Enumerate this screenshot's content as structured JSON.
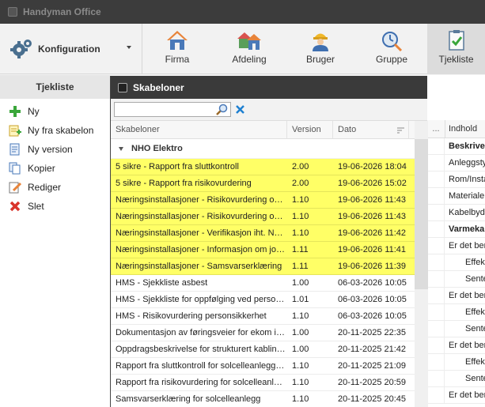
{
  "app": {
    "title": "Handyman Office"
  },
  "ribbon": {
    "config_label": "Konfiguration",
    "buttons": [
      {
        "label": "Firma",
        "icon": "house-icon"
      },
      {
        "label": "Afdeling",
        "icon": "houses-icon"
      },
      {
        "label": "Bruger",
        "icon": "worker-icon"
      },
      {
        "label": "Gruppe",
        "icon": "stopwatch-icon"
      },
      {
        "label": "Tjekliste",
        "icon": "checklist-icon"
      }
    ]
  },
  "sidebar": {
    "title": "Tjekliste",
    "items": [
      {
        "label": "Ny",
        "icon": "plus-icon"
      },
      {
        "label": "Ny fra skabelon",
        "icon": "template-add-icon"
      },
      {
        "label": "Ny version",
        "icon": "new-version-icon"
      },
      {
        "label": "Kopier",
        "icon": "copy-icon"
      },
      {
        "label": "Rediger",
        "icon": "edit-icon"
      },
      {
        "label": "Slet",
        "icon": "delete-icon"
      }
    ]
  },
  "dialog": {
    "title": "Skabeloner",
    "search": {
      "value": "",
      "placeholder": ""
    },
    "columns": {
      "name": "Skabeloner",
      "version": "Version",
      "date": "Dato",
      "more": "..."
    },
    "group": "NHO Elektro",
    "rows": [
      {
        "name": "5 sikre - Rapport fra sluttkontroll",
        "version": "2.00",
        "date": "19-06-2026 18:04",
        "highlight": true
      },
      {
        "name": "5 sikre - Rapport fra risikovurdering",
        "version": "2.00",
        "date": "19-06-2026 15:02",
        "highlight": true
      },
      {
        "name": "Næringsinstallasjoner - Risikovurdering og…",
        "version": "1.10",
        "date": "19-06-2026 11:43",
        "highlight": true
      },
      {
        "name": "Næringsinstallasjoner - Risikovurdering og…",
        "version": "1.10",
        "date": "19-06-2026 11:43",
        "highlight": true
      },
      {
        "name": "Næringsinstallasjoner - Verifikasjon iht. N…",
        "version": "1.10",
        "date": "19-06-2026 11:42",
        "highlight": true
      },
      {
        "name": "Næringsinstallasjoner - Informasjon om jo…",
        "version": "1.11",
        "date": "19-06-2026 11:41",
        "highlight": true
      },
      {
        "name": "Næringsinstallasjoner - Samsvarserklæring",
        "version": "1.11",
        "date": "19-06-2026 11:39",
        "highlight": true
      },
      {
        "name": "HMS - Sjekkliste asbest",
        "version": "1.00",
        "date": "06-03-2026 10:05",
        "highlight": false
      },
      {
        "name": "HMS - Sjekkliste for oppfølging ved person…",
        "version": "1.01",
        "date": "06-03-2026 10:05",
        "highlight": false
      },
      {
        "name": "HMS - Risikovurdering personsikkerhet",
        "version": "1.10",
        "date": "06-03-2026 10:05",
        "highlight": false
      },
      {
        "name": "Dokumentasjon av føringsveier for ekom i …",
        "version": "1.00",
        "date": "20-11-2025 22:35",
        "highlight": false
      },
      {
        "name": "Oppdragsbeskrivelse for strukturert kablin…",
        "version": "1.00",
        "date": "20-11-2025 21:42",
        "highlight": false
      },
      {
        "name": "Rapport fra sluttkontroll for solcelleanlegg…",
        "version": "1.10",
        "date": "20-11-2025 21:09",
        "highlight": false
      },
      {
        "name": "Rapport fra risikovurdering for solcelleanl…",
        "version": "1.10",
        "date": "20-11-2025 20:59",
        "highlight": false
      },
      {
        "name": "Samsvarserklæring for solcelleanlegg",
        "version": "1.10",
        "date": "20-11-2025 20:45",
        "highlight": false
      }
    ]
  },
  "content_panel": {
    "header": "Indhold",
    "rows": [
      {
        "text": "Beskrivelse",
        "style": "bold"
      },
      {
        "text": "Anleggstype",
        "style": "normal"
      },
      {
        "text": "Rom/Installasjon",
        "style": "normal"
      },
      {
        "text": "Materiale",
        "style": "normal"
      },
      {
        "text": "Kabelbydel",
        "style": "normal"
      },
      {
        "text": "Varmekabel",
        "style": "bold"
      },
      {
        "text": "Er det benyttet",
        "style": "normal"
      },
      {
        "text": "Effekt",
        "style": "indent"
      },
      {
        "text": "Sentes",
        "style": "indent"
      },
      {
        "text": "Er det benyttet",
        "style": "normal"
      },
      {
        "text": "Effekt",
        "style": "indent"
      },
      {
        "text": "Sentes",
        "style": "indent"
      },
      {
        "text": "Er det benyttet",
        "style": "normal"
      },
      {
        "text": "Effekt",
        "style": "indent"
      },
      {
        "text": "Sentes",
        "style": "indent"
      },
      {
        "text": "Er det benyttet",
        "style": "normal"
      }
    ]
  },
  "colors": {
    "highlight": "#ffff66",
    "titlebar": "#3c3c3c",
    "dialog_title": "#3a3a3a"
  }
}
